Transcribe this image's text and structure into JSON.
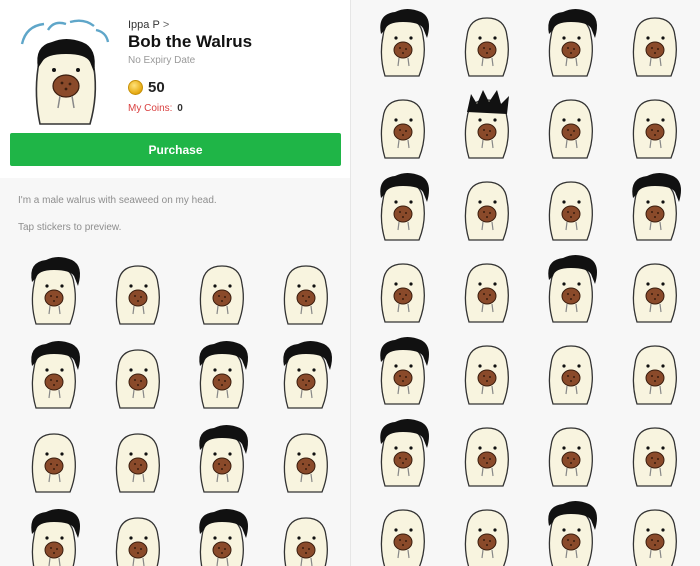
{
  "pack": {
    "author": "Ippa P",
    "title": "Bob the Walrus",
    "expiry": "No Expiry Date",
    "price": "50",
    "my_coins_label": "My Coins:",
    "my_coins_value": "0",
    "purchase_label": "Purchase",
    "description": "I'm a male walrus with seaweed on my head.",
    "tap_hint": "Tap stickers to preview."
  },
  "colors": {
    "purchase_green": "#1fb547",
    "coin_gold": "#e6a910",
    "my_coins_red": "#d94040",
    "sticker_body": "#f8f4df",
    "sticker_outline": "#333333",
    "seaweed": "#8a4a2a"
  },
  "left_stickers": [
    {
      "id": "l1",
      "hair": "bob"
    },
    {
      "id": "l2",
      "hair": "none"
    },
    {
      "id": "l3",
      "hair": "none"
    },
    {
      "id": "l4",
      "hair": "none"
    },
    {
      "id": "l5",
      "hair": "bob"
    },
    {
      "id": "l6",
      "hair": "none"
    },
    {
      "id": "l7",
      "hair": "bob"
    },
    {
      "id": "l8",
      "hair": "bob"
    },
    {
      "id": "l9",
      "hair": "none"
    },
    {
      "id": "l10",
      "hair": "none"
    },
    {
      "id": "l11",
      "hair": "bob"
    },
    {
      "id": "l12",
      "hair": "none"
    },
    {
      "id": "l13",
      "hair": "bob"
    },
    {
      "id": "l14",
      "hair": "none"
    },
    {
      "id": "l15",
      "hair": "bob"
    },
    {
      "id": "l16",
      "hair": "none"
    }
  ],
  "right_stickers": [
    {
      "id": "r1",
      "hair": "bob"
    },
    {
      "id": "r2",
      "hair": "none"
    },
    {
      "id": "r3",
      "hair": "bob"
    },
    {
      "id": "r4",
      "hair": "none"
    },
    {
      "id": "r5",
      "hair": "none"
    },
    {
      "id": "r6",
      "hair": "spiky"
    },
    {
      "id": "r7",
      "hair": "none"
    },
    {
      "id": "r8",
      "hair": "none"
    },
    {
      "id": "r9",
      "hair": "bob"
    },
    {
      "id": "r10",
      "hair": "none"
    },
    {
      "id": "r11",
      "hair": "none"
    },
    {
      "id": "r12",
      "hair": "bob"
    },
    {
      "id": "r13",
      "hair": "none"
    },
    {
      "id": "r14",
      "hair": "none"
    },
    {
      "id": "r15",
      "hair": "bob"
    },
    {
      "id": "r16",
      "hair": "none"
    },
    {
      "id": "r17",
      "hair": "bob"
    },
    {
      "id": "r18",
      "hair": "none"
    },
    {
      "id": "r19",
      "hair": "none"
    },
    {
      "id": "r20",
      "hair": "none"
    },
    {
      "id": "r21",
      "hair": "bob"
    },
    {
      "id": "r22",
      "hair": "none"
    },
    {
      "id": "r23",
      "hair": "none"
    },
    {
      "id": "r24",
      "hair": "none"
    },
    {
      "id": "r25",
      "hair": "none"
    },
    {
      "id": "r26",
      "hair": "none"
    },
    {
      "id": "r27",
      "hair": "bob"
    },
    {
      "id": "r28",
      "hair": "none"
    }
  ]
}
